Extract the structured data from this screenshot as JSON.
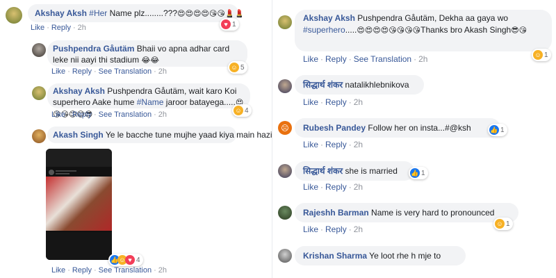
{
  "left": {
    "comments": [
      {
        "author": "Akshay Aksh",
        "tag": "#Her",
        "text": " Name plz........???",
        "emojis": "😍😍😍😍😘😘💄💄",
        "like_label": "Like",
        "reply_label": "Reply",
        "time": "2h",
        "reaction_type": "love",
        "reaction_count": "1"
      },
      {
        "author": "Pushpendra Gåutäm",
        "text": "Bhaii vo apna adhar card leke nii aayi thi stadium",
        "emojis": "😂😂",
        "like_label": "Like",
        "reply_label": "Reply",
        "see_translation": "See Translation",
        "time": "2h",
        "reaction_type": "haha",
        "reaction_count": "5"
      },
      {
        "author": "Akshay Aksh",
        "text_pre": "Pushpendra Gåutäm, wait karo Koi superhero Aake hume ",
        "tag": "#Name",
        "text_post": " jaroor batayega.....",
        "emojis": "😍😘😘😊😊😎",
        "like_label": "Like",
        "reply_label": "Reply",
        "see_translation": "See Translation",
        "time": "2h",
        "reaction_type": "haha",
        "reaction_count": "4"
      },
      {
        "author": "Akash Singh",
        "text": "Ye le bacche tune mujhe yaad kiya main hazir",
        "like_label": "Like",
        "reply_label": "Reply",
        "see_translation": "See Translation",
        "time": "2h",
        "reaction_count": "4"
      }
    ]
  },
  "right": {
    "comments": [
      {
        "author": "Akshay Aksh",
        "text_pre": "Pushpendra Gåutäm, Dekha aa gaya wo ",
        "tag": "#superhero",
        "text_mid": ".....",
        "emojis1": "😍😍😍😍😘😘😘😘",
        "text_post": "Thanks bro Akash Singh",
        "emojis2": "😎😘",
        "like_label": "Like",
        "reply_label": "Reply",
        "see_translation": "See Translation",
        "time": "2h",
        "reaction_type": "haha",
        "reaction_count": "1"
      },
      {
        "author": "सिद्धार्थ शंकर",
        "text": "natalikhlebnikova",
        "like_label": "Like",
        "reply_label": "Reply",
        "time": "2h"
      },
      {
        "author": "Rubesh Pandey",
        "text": "Follow her on insta...#@ksh",
        "like_label": "Like",
        "reply_label": "Reply",
        "time": "2h",
        "reaction_type": "like",
        "reaction_count": "1"
      },
      {
        "author": "सिद्धार्थ शंकर",
        "text": "she is married",
        "like_label": "Like",
        "reply_label": "Reply",
        "time": "2h",
        "reaction_type": "like",
        "reaction_count": "1"
      },
      {
        "author": "Rajeshh Barman",
        "text": "Name is very hard to pronounced",
        "like_label": "Like",
        "reply_label": "Reply",
        "time": "2h",
        "reaction_type": "haha",
        "reaction_count": "1"
      },
      {
        "author": "Krishan Sharma",
        "text": "Ye loot rhe h mje to"
      }
    ]
  },
  "colors": {
    "author": "#385898",
    "bubble": "#f2f3f5",
    "meta": "#90949c"
  }
}
